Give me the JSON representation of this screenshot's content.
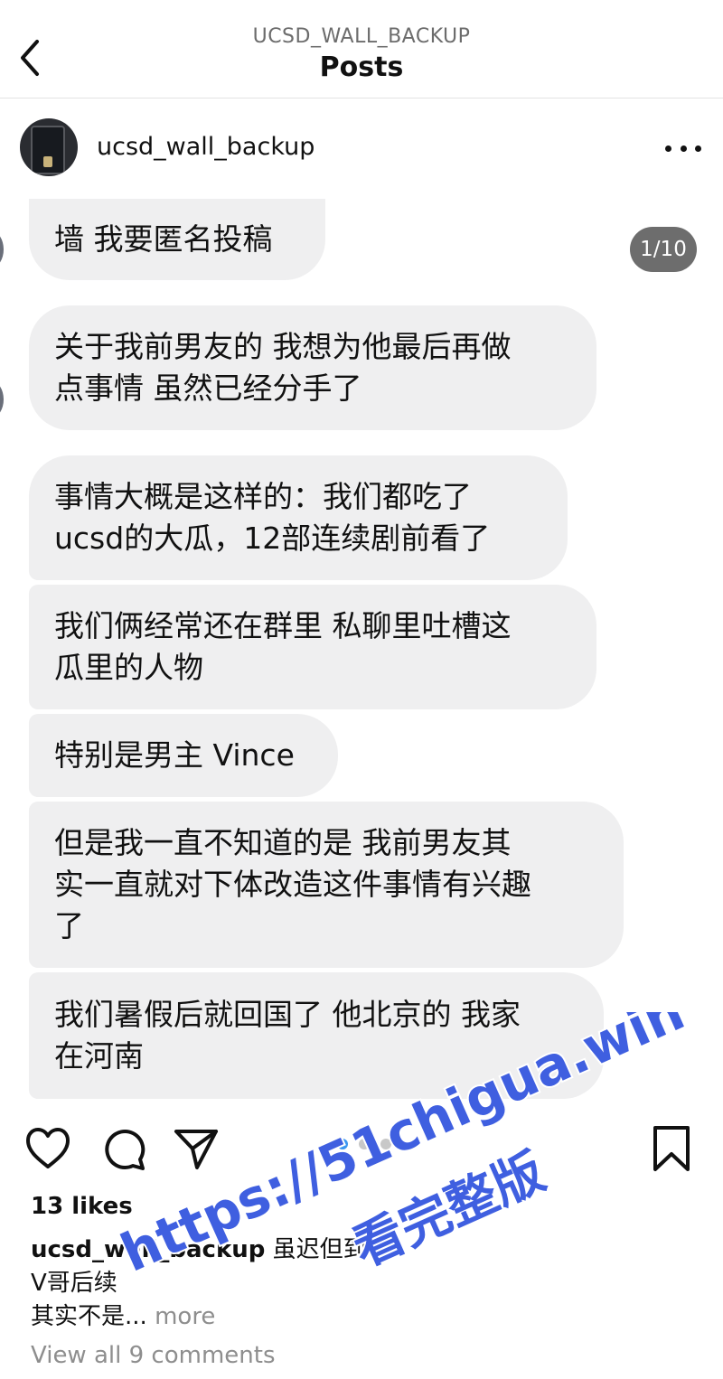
{
  "header": {
    "back_icon": "chevron-left-icon",
    "handle": "UCSD_WALL_BACKUP",
    "title": "Posts"
  },
  "profile": {
    "username": "ucsd_wall_backup",
    "more_icon": "ellipsis-icon"
  },
  "post": {
    "page_counter": "1/10",
    "messages": [
      "墙 我要匿名投稿",
      "关于我前男友的 我想为他最后再做\n点事情 虽然已经分手了",
      "事情大概是这样的：我们都吃了\nucsd的大瓜，12部连续剧前看了",
      "我们俩经常还在群里 私聊里吐槽这\n瓜里的人物",
      "特别是男主 Vince",
      "但是我一直不知道的是 我前男友其\n实一直就对下体改造这件事情有兴趣\n了",
      "我们暑假后就回国了 他北京的 我家\n在河南"
    ],
    "carousel": {
      "current": 1,
      "dot_count": 3
    }
  },
  "actions": {
    "like_icon": "heart-icon",
    "comment_icon": "comment-icon",
    "share_icon": "paper-plane-icon",
    "save_icon": "bookmark-icon"
  },
  "likes": "13 likes",
  "caption": {
    "username": "ucsd_wall_backup",
    "line1": "虽迟但到",
    "line2": "V哥后续",
    "line3": "其实不是",
    "ellipsis": "...",
    "more_label": "more"
  },
  "comments_link": "View all 9 comments",
  "watermark": {
    "url": "https://51chigua.win",
    "subtitle": "看完整版",
    "color": "#3f5fe0"
  },
  "colors": {
    "bubble": "#efeff0",
    "counter_bg": "#6d6d6d",
    "active_dot": "#3b97f0",
    "inactive_dot": "#c8c8c8",
    "muted_text": "#8e8e8e"
  }
}
